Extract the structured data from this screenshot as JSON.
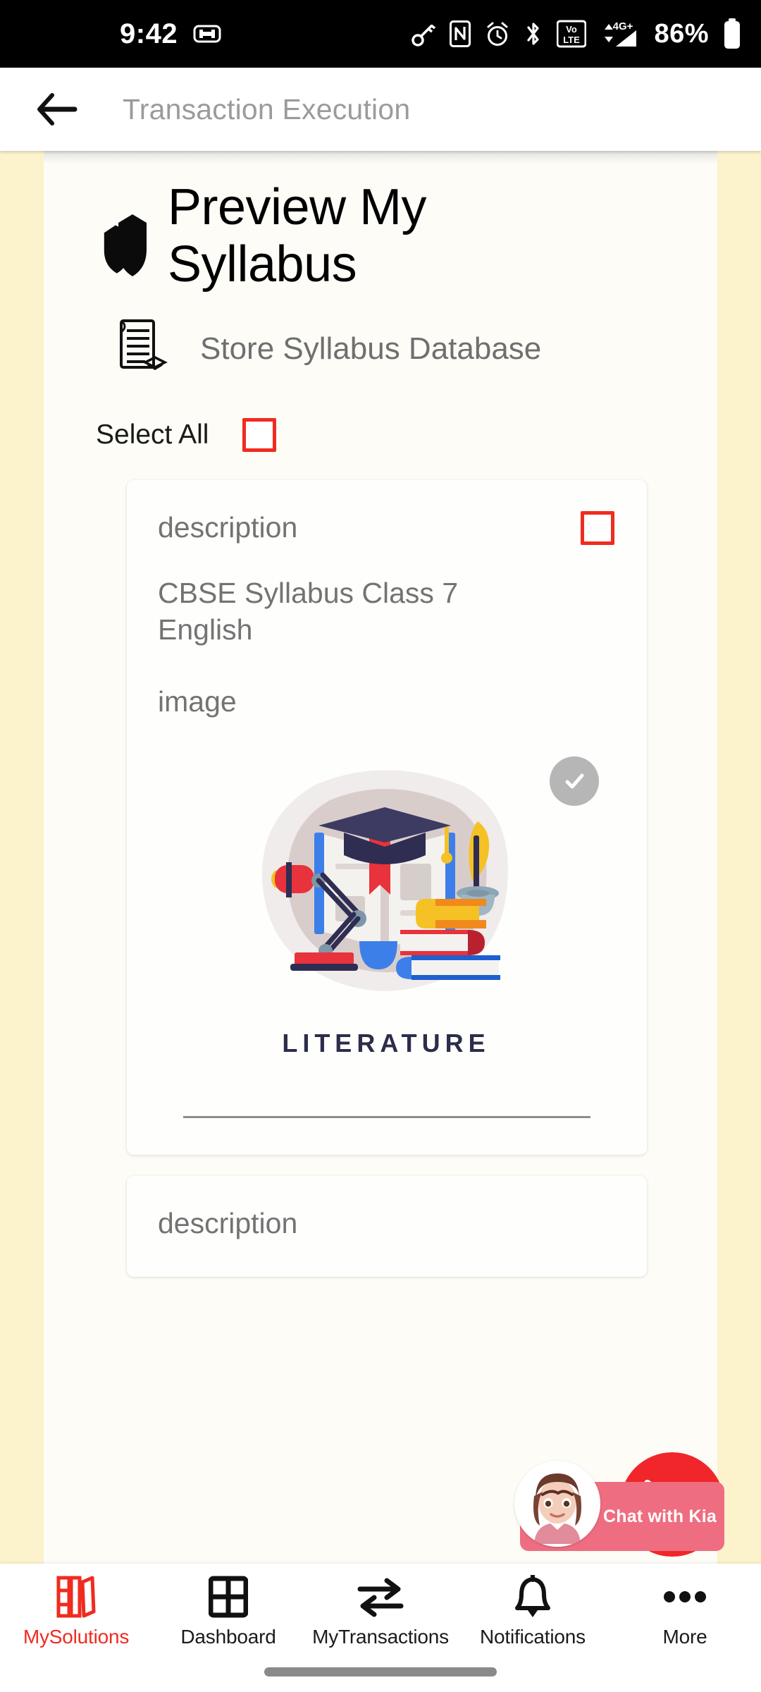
{
  "status_bar": {
    "time": "9:42",
    "battery_percent": "86%",
    "network": "4G+",
    "volte": "VoLTE",
    "icons": [
      "usb-plug-icon",
      "key-icon",
      "nfc-icon",
      "alarm-icon",
      "bluetooth-icon",
      "volte-icon",
      "signal-icon",
      "battery-icon"
    ]
  },
  "app_bar": {
    "back_icon": "arrow-left-icon",
    "title": "Transaction Execution"
  },
  "hero": {
    "icon": "shield-icon",
    "title": "Preview My Syllabus"
  },
  "subsection": {
    "icon": "database-document-icon",
    "label": "Store Syllabus Database"
  },
  "select_all": {
    "label": "Select All",
    "checked": false
  },
  "cards": [
    {
      "description_key": "description",
      "description_value": "CBSE Syllabus Class 7 English",
      "image_key": "image",
      "image_caption": "LITERATURE",
      "checkbox_checked": false,
      "image_badge_icon": "check-circle-icon"
    },
    {
      "description_key": "description"
    }
  ],
  "chat_widget": {
    "label": "Chat with Kia",
    "avatar": "kia-avatar",
    "badge_icon": "chat-launcher-icon"
  },
  "bottom_nav": {
    "items": [
      {
        "label": "MySolutions",
        "icon": "books-icon",
        "active": true
      },
      {
        "label": "Dashboard",
        "icon": "grid-icon",
        "active": false
      },
      {
        "label": "MyTransactions",
        "icon": "exchange-arrows-icon",
        "active": false
      },
      {
        "label": "Notifications",
        "icon": "bell-icon",
        "active": false
      },
      {
        "label": "More",
        "icon": "ellipsis-icon",
        "active": false
      }
    ]
  },
  "colors": {
    "accent_red": "#F02B20",
    "page_side": "#FCF2CC",
    "sheet": "#FDFCF7",
    "chat_red": "#F0262A",
    "chat_pink": "#EF6D80"
  }
}
